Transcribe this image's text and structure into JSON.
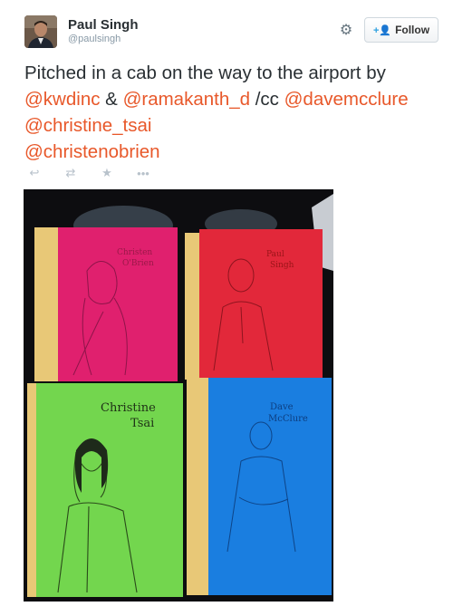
{
  "user": {
    "display_name": "Paul Singh",
    "handle": "@paulsingh"
  },
  "header": {
    "follow_label": "Follow",
    "settings_icon": "gear-icon",
    "follow_icon": "person-add-icon"
  },
  "tweet": {
    "prefix": "Pitched in a cab on the way to the airport by ",
    "mention_1": "@kwdinc",
    "amp": " & ",
    "mention_2": "@ramakanth_d",
    "cc": " /cc ",
    "mention_3": "@davemcclure",
    "space": " ",
    "mention_4": "@christine_tsai",
    "mention_5": "@christenobrien"
  },
  "actions": [
    "reply-icon",
    "retweet-icon",
    "favorite-icon",
    "more-icon"
  ],
  "photo": {
    "notebooks": [
      {
        "label_line1": "Christen",
        "label_line2": "O'Brien",
        "color": "#e0206e"
      },
      {
        "label_line1": "Paul",
        "label_line2": "Singh",
        "color": "#e2283a"
      },
      {
        "label_line1": "Christine",
        "label_line2": "Tsai",
        "color": "#73d64e"
      },
      {
        "label_line1": "Dave",
        "label_line2": "McClure",
        "color": "#1a7ee0"
      }
    ]
  },
  "colors": {
    "mention": "#e8582a",
    "text": "#292f33",
    "muted": "#8899a6"
  }
}
